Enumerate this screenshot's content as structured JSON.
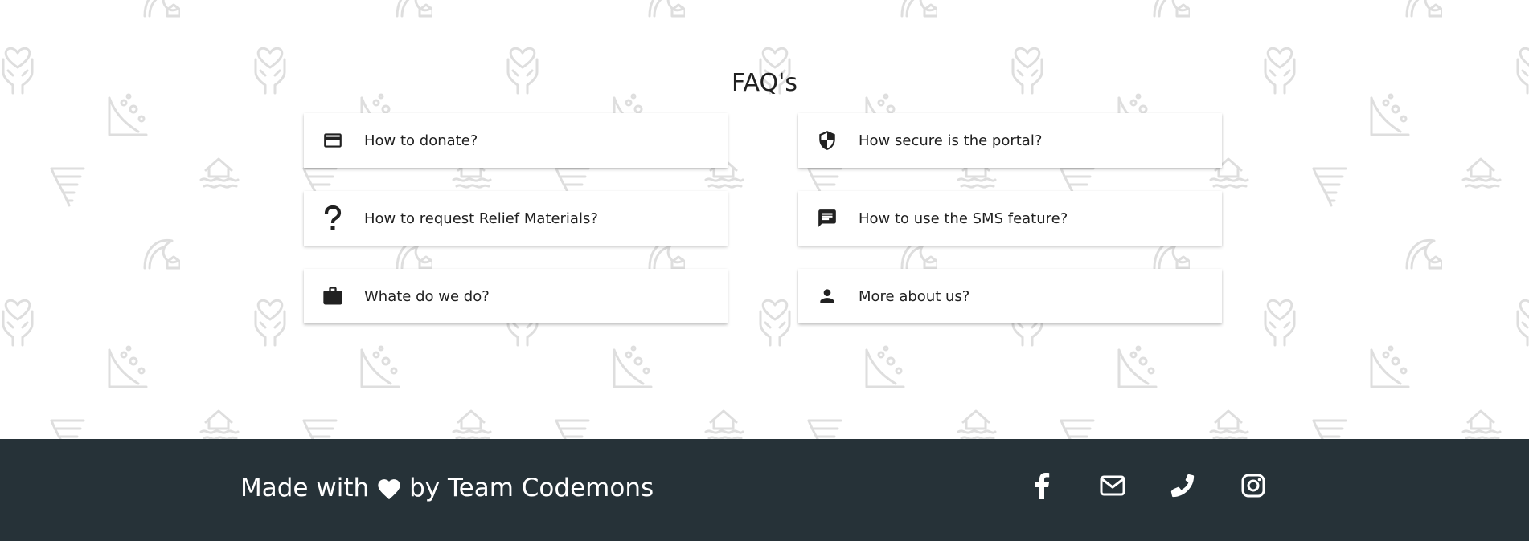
{
  "faq": {
    "title": "FAQ's",
    "items": [
      {
        "label": "How to donate?",
        "icon": "credit-card-icon"
      },
      {
        "label": "How secure is the portal?",
        "icon": "shield-icon"
      },
      {
        "label": "How to request Relief Materials?",
        "icon": "question-mark-icon"
      },
      {
        "label": "How to use the SMS feature?",
        "icon": "message-icon"
      },
      {
        "label": "Whate do we do?",
        "icon": "briefcase-icon"
      },
      {
        "label": "More about us?",
        "icon": "person-icon"
      }
    ]
  },
  "footer": {
    "text_before": "Made with",
    "text_after": "by Team Codemons",
    "heart_icon": "heart-icon",
    "social": [
      {
        "icon": "facebook-icon"
      },
      {
        "icon": "mail-icon"
      },
      {
        "icon": "phone-icon"
      },
      {
        "icon": "instagram-icon"
      }
    ]
  },
  "colors": {
    "footer_bg": "#263238",
    "pattern": "#e6e6e6",
    "text": "#212121"
  }
}
